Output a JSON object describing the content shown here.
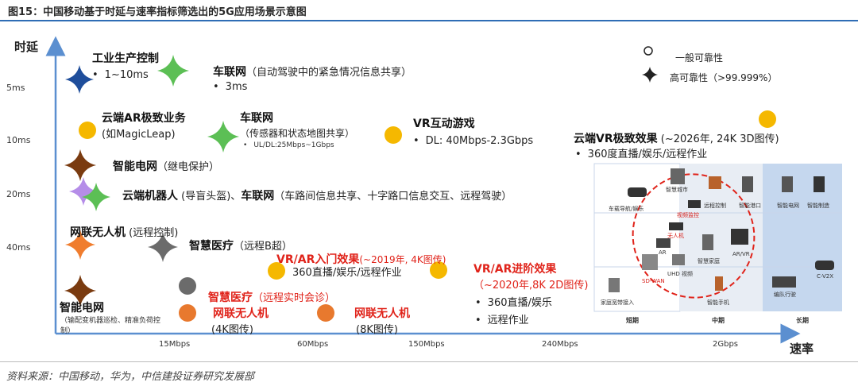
{
  "figure": {
    "title": "图15：中国移动基于时延与速率指标筛选出的5G应用场景示意图",
    "source": "资料来源：中国移动，华为，中信建投证券研究发展部"
  },
  "chart_data": {
    "type": "scatter",
    "xlabel": "速率",
    "ylabel": "时延",
    "x_ticks": [
      "15Mbps",
      "60Mbps",
      "150Mbps",
      "240Mbps",
      "2Gbps"
    ],
    "y_ticks": [
      "5ms",
      "10ms",
      "20ms",
      "40ms"
    ],
    "legend": {
      "normal": "一般可靠性",
      "high": "高可靠性（>99.999%）"
    },
    "points": [
      {
        "id": "p1",
        "marker": "star",
        "color": "#1f4e9b"
      },
      {
        "id": "p2",
        "marker": "star",
        "color": "#5cbf55"
      },
      {
        "id": "p3",
        "marker": "circle",
        "color": "#f5b800"
      },
      {
        "id": "p4",
        "marker": "star",
        "color": "#5cbf55"
      },
      {
        "id": "p5",
        "marker": "circle",
        "color": "#f5b800"
      },
      {
        "id": "p6",
        "marker": "circle",
        "color": "#f5b800"
      },
      {
        "id": "p7",
        "marker": "star",
        "color": "#7a3b10"
      },
      {
        "id": "p8",
        "marker": "star",
        "color": "#b58de8"
      },
      {
        "id": "p9",
        "marker": "star",
        "color": "#5cbf55"
      },
      {
        "id": "p10",
        "marker": "star",
        "color": "#f07d2e"
      },
      {
        "id": "p11",
        "marker": "star",
        "color": "#6b6b6b"
      },
      {
        "id": "p12",
        "marker": "circle",
        "color": "#f5b800"
      },
      {
        "id": "p13",
        "marker": "circle",
        "color": "#f5b800"
      },
      {
        "id": "p14",
        "marker": "star",
        "color": "#7a3b10"
      },
      {
        "id": "p15",
        "marker": "circle",
        "color": "#6b6b6b"
      },
      {
        "id": "p16",
        "marker": "circle",
        "color": "#e8792e"
      },
      {
        "id": "p17",
        "marker": "circle",
        "color": "#e8792e"
      }
    ],
    "labels": {
      "industrial": {
        "name": "工业生产控制",
        "detail": "1~10ms"
      },
      "v2x_a": {
        "name": "车联网",
        "detail": "（自动驾驶中的紧急情况信息共享）",
        "value": "3ms"
      },
      "ar_cloud": {
        "name": "云端AR极致业务",
        "detail": "(如MagicLeap)"
      },
      "v2x_b": {
        "name": "车联网",
        "detail": "（传感器和状态地图共享）",
        "sub": "UL/DL:25Mbps~1Gbps"
      },
      "vr_game": {
        "name": "VR互动游戏",
        "detail": "DL: 40Mbps-2.3Gbps"
      },
      "vr_cloud": {
        "name": "云端VR极致效果",
        "period": " (~2026年, 24K 3D图传)",
        "detail": "360度直播/娱乐/远程作业"
      },
      "grid": {
        "name": "智能电网",
        "detail": "（继电保护）"
      },
      "robot": {
        "name": "云端机器人",
        "detail": " (导盲头盔)、",
        "name2": "车联网",
        "detail2": "（车路间信息共享、十字路口信息交互、远程驾驶）"
      },
      "drone": {
        "name": "网联无人机",
        "detail": " (远程控制)"
      },
      "medical_a": {
        "name": "智慧医疗",
        "detail": "（远程B超）"
      },
      "arvr_entry": {
        "name": "VR/AR入门效果",
        "period": "(~2019年, 4K图传)",
        "detail": "360直播/娱乐/远程作业"
      },
      "arvr_adv": {
        "name": "VR/AR进阶效果",
        "period": "（~2020年,8K 2D图传)",
        "detail1": "360直播/娱乐",
        "detail2": "远程作业"
      },
      "grid_b": {
        "name": "智能电网",
        "detail": "（输配变机器巡检、精准负荷控",
        "detail_b": "制）"
      },
      "medical_b": {
        "name": "智慧医疗",
        "detail": "（远程实时会诊）"
      },
      "drone_4k": {
        "name": "网联无人机",
        "detail": "(4K图传)"
      },
      "drone_8k": {
        "name": "网联无人机",
        "detail": "(8K图传)"
      }
    }
  },
  "inset": {
    "periods": [
      "短期",
      "中期",
      "长期"
    ],
    "items": [
      "车载导航/娱乐",
      "智慧城市",
      "远程控制",
      "视频监控",
      "智能港口",
      "智能电网",
      "智能制造",
      "无人机",
      "AR",
      "智慧家庭",
      "AR/VR",
      "SD-WAN",
      "UHD 视频",
      "家庭宽带接入",
      "智能手机",
      "编队行驶",
      "C-V2X"
    ]
  }
}
